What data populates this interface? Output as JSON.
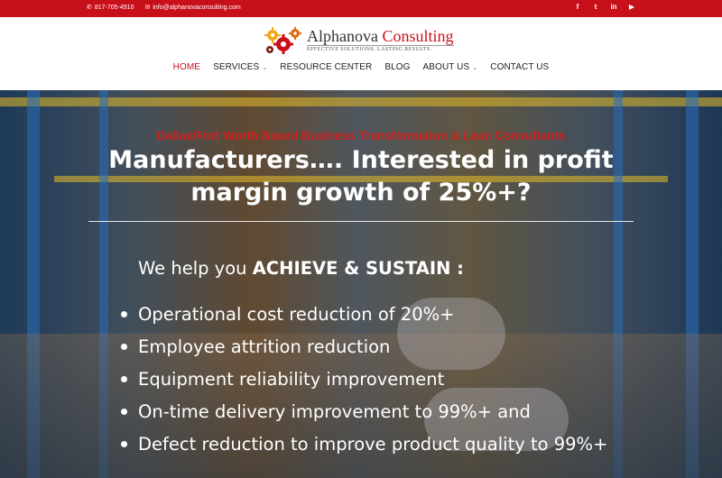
{
  "topbar": {
    "phone": "817-705-4910",
    "email": "info@alphanovaconsulting.com",
    "social": [
      "facebook-icon",
      "twitter-icon",
      "linkedin-icon",
      "youtube-icon"
    ]
  },
  "brand": {
    "name_part1": "Alphanova",
    "name_part2": " Consulting",
    "tagline": "EFFECTIVE SOLUTIONS. LASTING RESULTS.",
    "accent_color": "#c8101b"
  },
  "nav": {
    "items": [
      {
        "label": "HOME",
        "active": true
      },
      {
        "label": "SERVICES",
        "dropdown": true
      },
      {
        "label": "RESOURCE CENTER"
      },
      {
        "label": "BLOG"
      },
      {
        "label": "ABOUT US",
        "dropdown": true
      },
      {
        "label": "CONTACT US"
      }
    ]
  },
  "hero": {
    "subtitle": "Dallas/Fort Worth Based Business Transformation & Lean Consultants",
    "headline_line1": "Manufacturers…. Interested in profit",
    "headline_line2": "margin growth of 25%+?",
    "intro_prefix": "We help you ",
    "intro_strong": "ACHIEVE & SUSTAIN :",
    "bullets": [
      "Operational cost reduction of 20%+",
      "Employee attrition reduction",
      "Equipment reliability improvement",
      "On-time delivery improvement to 99%+ and",
      "Defect reduction to improve product quality to 99%+"
    ]
  }
}
